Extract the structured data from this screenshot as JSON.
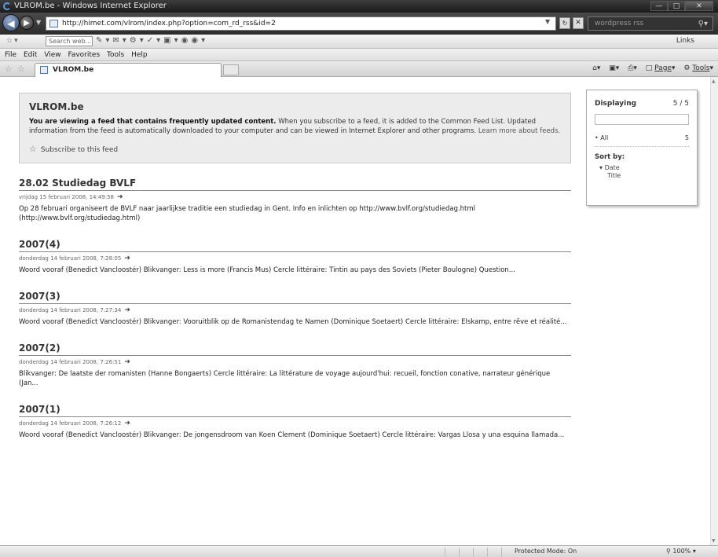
{
  "window": {
    "title": "VLROM.be - Windows Internet Explorer"
  },
  "address": {
    "url": "http://himet.com/vlrom/index.php?option=com_rd_rss&id=2",
    "search_text": "wordpress rss"
  },
  "toolbar": {
    "search_placeholder": "Search web...",
    "links_label": "Links"
  },
  "menu": {
    "items": [
      "File",
      "Edit",
      "View",
      "Favorites",
      "Tools",
      "Help"
    ]
  },
  "tab": {
    "title": "VLROM.be"
  },
  "command_bar": {
    "page_label": "Page",
    "tools_label": "Tools"
  },
  "feed": {
    "title": "VLROM.be",
    "intro_bold": "You are viewing a feed that contains frequently updated content.",
    "intro_rest": " When you subscribe to a feed, it is added to the Common Feed List. Updated information from the feed is automatically downloaded to your computer and can be viewed in Internet Explorer and other programs. ",
    "learn_more": "Learn more about feeds.",
    "subscribe_label": "Subscribe to this feed"
  },
  "items": [
    {
      "title": "28.02 Studiedag BVLF",
      "date": "vrijdag 15 februari 2008, 14:49:58",
      "body": "Op 28 februari organiseert de BVLF naar jaarlijkse traditie een studiedag in Gent. Info en inlichten op http://www.bvlf.org/studiedag.html (http://www.bvlf.org/studiedag.html)"
    },
    {
      "title": "2007(4)",
      "date": "donderdag 14 februari 2008, 7:28:05",
      "body": "Woord vooraf (Benedict Vancloostér) Blikvanger: Less is more (Francis Mus) Cercle littéraire: Tintin au pays des Soviets (Pieter Boulogne) Question..."
    },
    {
      "title": "2007(3)",
      "date": "donderdag 14 februari 2008, 7:27:34",
      "body": "Woord vooraf (Benedict Vancloostér) Blikvanger: Vooruitblik op de Romanistendag te Namen (Dominique Soetaert) Cercle littéraire: Elskamp, entre rêve et réalité..."
    },
    {
      "title": "2007(2)",
      "date": "donderdag 14 februari 2008, 7:26:51",
      "body": "Blikvanger: De laatste der romanisten (Hanne Bongaerts) Cercle littéraire: La littérature de voyage aujourd'hui: recueil, fonction conative, narrateur générique (Jan..."
    },
    {
      "title": "2007(1)",
      "date": "donderdag 14 februari 2008, 7:26:12",
      "body": "Woord vooraf (Benedict Vancloostér) Blikvanger: De jongensdroom van Koen Clement (Dominique Soetaert) Cercle littéraire: Vargas Llosa y una esquina llamada..."
    }
  ],
  "filter": {
    "displaying_label": "Displaying",
    "displaying_count": "5 / 5",
    "all_label": "All",
    "all_count": "5",
    "sort_label": "Sort by:",
    "sort_date": "Date",
    "sort_title": "Title"
  },
  "status": {
    "protected_mode": "Protected Mode: On",
    "zoom": "100%"
  }
}
